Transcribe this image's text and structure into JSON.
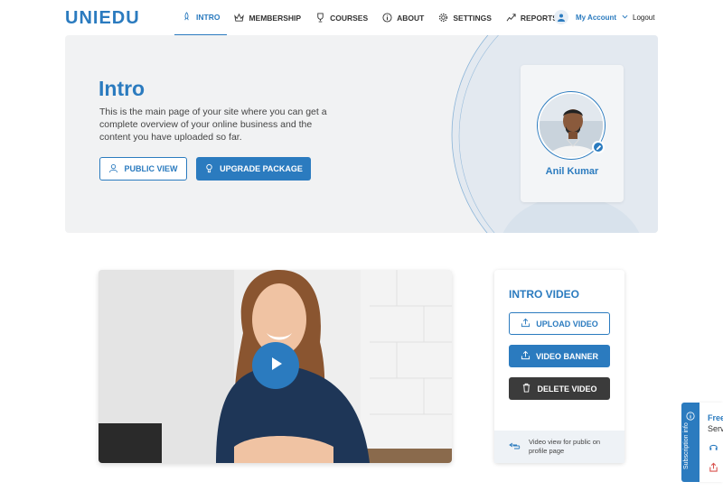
{
  "header": {
    "logo": "UNIEDU",
    "nav": [
      {
        "label": "INTRO",
        "icon": "rocket-icon",
        "active": true
      },
      {
        "label": "MEMBERSHIP",
        "icon": "crown-icon"
      },
      {
        "label": "COURSES",
        "icon": "trophy-icon"
      },
      {
        "label": "ABOUT",
        "icon": "info-icon"
      },
      {
        "label": "SETTINGS",
        "icon": "gear-icon"
      },
      {
        "label": "REPORTS",
        "icon": "chart-icon"
      }
    ],
    "account_label": "My Account",
    "logout_label": "Logout"
  },
  "hero": {
    "title": "Intro",
    "description": "This is the main page of your site where you can get a complete overview of your online business and the content you have uploaded so far.",
    "public_view_label": "PUBLIC VIEW",
    "upgrade_label": "UPGRADE PACKAGE",
    "profile_name": "Anil Kumar"
  },
  "intro_video": {
    "title": "INTRO VIDEO",
    "upload_label": "UPLOAD VIDEO",
    "banner_label": "VIDEO BANNER",
    "delete_label": "DELETE VIDEO",
    "footer_text": "Video view for public on profile page"
  },
  "side": {
    "subscription_label": "Subscription info",
    "peek_text_1": "Free",
    "peek_text_2": "Serv"
  },
  "colors": {
    "primary": "#2b7bbf",
    "dark_button": "#3b3b3b",
    "hero_bg": "#f1f2f3"
  }
}
